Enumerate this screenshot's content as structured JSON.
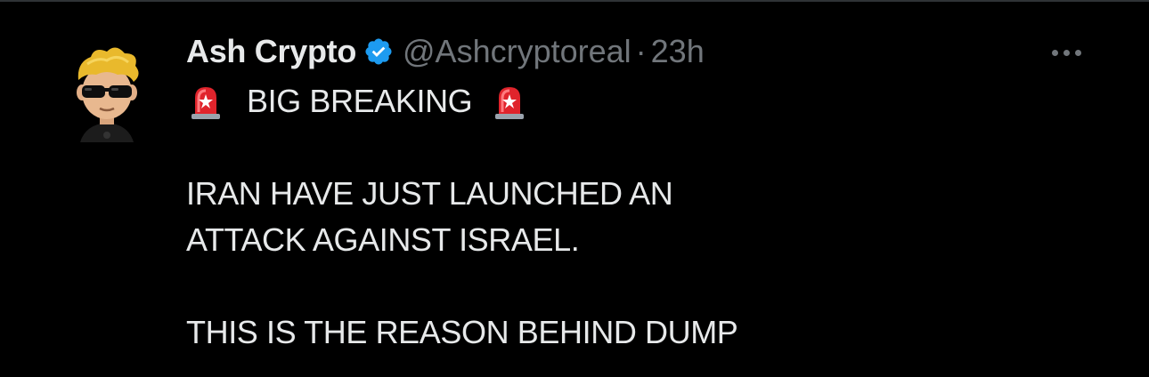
{
  "tweet": {
    "author": {
      "display_name": "Ash Crypto",
      "handle": "@Ashcryptoreal",
      "verified": true,
      "avatar_icon": "cartoon-avatar-sunglasses-icon"
    },
    "separator": "·",
    "timestamp": "23h",
    "more_icon": "more-horizontal-icon",
    "siren_icon": "police-siren-emoji",
    "lines": {
      "headline": "BIG BREAKING",
      "body_1": "IRAN HAVE JUST LAUNCHED AN",
      "body_2": "ATTACK AGAINST ISRAEL.",
      "body_3": "THIS IS THE REASON BEHIND DUMP"
    }
  },
  "colors": {
    "background": "#000000",
    "text_primary": "#e7e9ea",
    "text_secondary": "#71767b",
    "verified_badge": "#1d9bf0",
    "divider": "#2f3336"
  }
}
